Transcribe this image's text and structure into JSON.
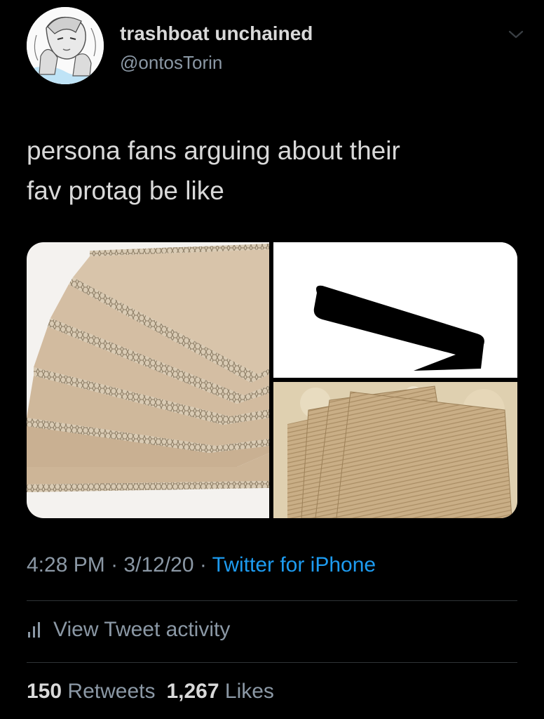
{
  "tweet": {
    "display_name": "trashboat unchained",
    "handle": "@ontosTorin",
    "text_line1": "persona fans arguing about their",
    "text_line2": "fav protag be like",
    "time": "4:28 PM",
    "separator": "·",
    "date": "3/12/20",
    "source": "Twitter for iPhone",
    "activity_label": "View Tweet activity",
    "retweets_count": "150",
    "retweets_label": "Retweets",
    "likes_count": "1,267",
    "likes_label": "Likes"
  },
  "media": {
    "left_image": "stacked honeycomb cardboard sheets",
    "top_right_image": "black angled shape on white",
    "bottom_right_image": "corrugated cardboard sheets"
  },
  "colors": {
    "background": "#000000",
    "primary_text": "#d9d9d9",
    "secondary_text": "#8b98a5",
    "link": "#1d9bf0",
    "divider": "#2f3336"
  },
  "icons": {
    "caret": "chevron-down-icon",
    "activity": "bar-chart-icon"
  }
}
